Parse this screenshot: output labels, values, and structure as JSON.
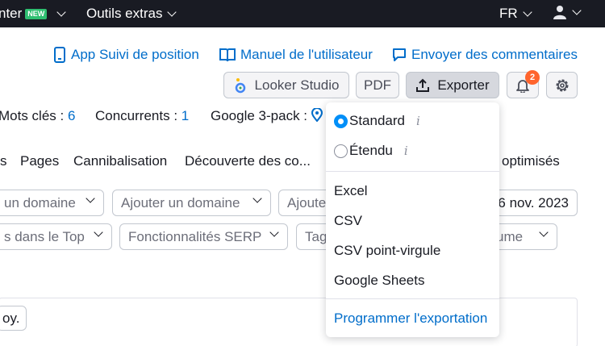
{
  "topbar": {
    "left_item": "nter",
    "left_badge": "NEW",
    "extras": "Outils extras",
    "lang": "FR"
  },
  "links": {
    "app": "App Suivi de position",
    "manual": "Manuel de l'utilisateur",
    "feedback": "Envoyer des commentaires"
  },
  "toolbar": {
    "looker": "Looker Studio",
    "pdf": "PDF",
    "export": "Exporter",
    "notif_count": "2"
  },
  "stats": {
    "keywords_label": "Mots clés : ",
    "keywords_value": "6",
    "competitors_label": "Concurrents : ",
    "competitors_value": "1",
    "pack_label": "Google 3-pack : "
  },
  "tabs": [
    "s",
    "Pages",
    "Cannibalisation",
    "Découverte des co...",
    "optimisés"
  ],
  "filters": {
    "domain1": "un domaine",
    "domain2": "Ajouter un domaine",
    "domain3": "Ajoute",
    "date": "6 nov. 2023",
    "top": "s dans le Top",
    "serp": "Fonctionnalités SERP",
    "tag": "Tag",
    "volume": "ume"
  },
  "table": {
    "button": "oy."
  },
  "export_menu": {
    "standard": "Standard",
    "extended": "Étendu",
    "selected": "standard",
    "formats": [
      "Excel",
      "CSV",
      "CSV point-virgule",
      "Google Sheets"
    ],
    "schedule": "Programmer l'exportation"
  },
  "colors": {
    "topbar_bg": "#191b23",
    "link_blue": "#006dca",
    "new_badge": "#2fbf71",
    "notif_orange": "#ff642d",
    "radio_blue": "#008ff8"
  }
}
